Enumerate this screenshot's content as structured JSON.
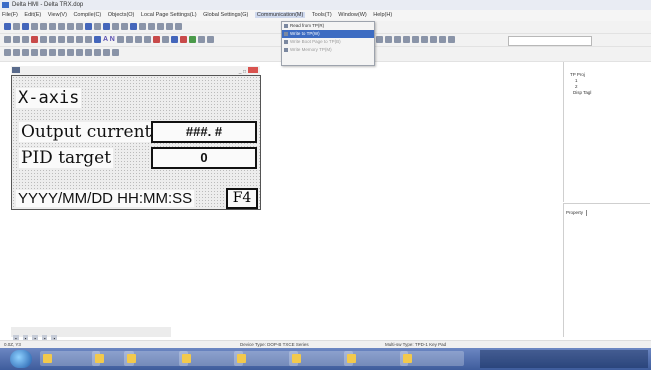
{
  "window": {
    "title": "Delta HMI - Delta TRX.dop"
  },
  "menubar": {
    "items": [
      "File(F)",
      "Edit(E)",
      "View(V)",
      "Compile(C)",
      "Objects(O)",
      "Local Page Settings(L)",
      "Global Settings(G)",
      "Communication(M)",
      "Tools(T)",
      "Window(W)",
      "Help(H)"
    ],
    "active_index": 7
  },
  "comm_menu": {
    "items": [
      {
        "label": "Read from TP(R)",
        "state": "normal"
      },
      {
        "label": "Write to TP(W)",
        "state": "highlighted"
      },
      {
        "label": "Write Boot Page to TP(B)",
        "state": "disabled"
      },
      {
        "label": "Write Memory TP(M)",
        "state": "disabled"
      }
    ]
  },
  "toolbar": {
    "text_tool_label": "A N",
    "font_box": ""
  },
  "screen": {
    "title": "X-axis",
    "output_label": "Output current",
    "output_value": "###. #",
    "pid_label": "PID target",
    "pid_value": "0",
    "datetime": "YYYY/MM/DD  HH:MM:SS",
    "fkey": "F4"
  },
  "tree": {
    "root": "TP Proj",
    "child1": "1",
    "child2": "2",
    "child3": "Disp Tagl"
  },
  "properties": {
    "header": "Property"
  },
  "statusbar": {
    "coords": "0.0Z, Y3",
    "device": "Device Type: DOP-B TXCE Series",
    "multi": "Multi-sw Type: TPD-1 Key Pad"
  },
  "colors": {
    "menu_highlight": "#3d6cc2",
    "close_button": "#d9534f",
    "taskbar": "#3e5c9c"
  }
}
